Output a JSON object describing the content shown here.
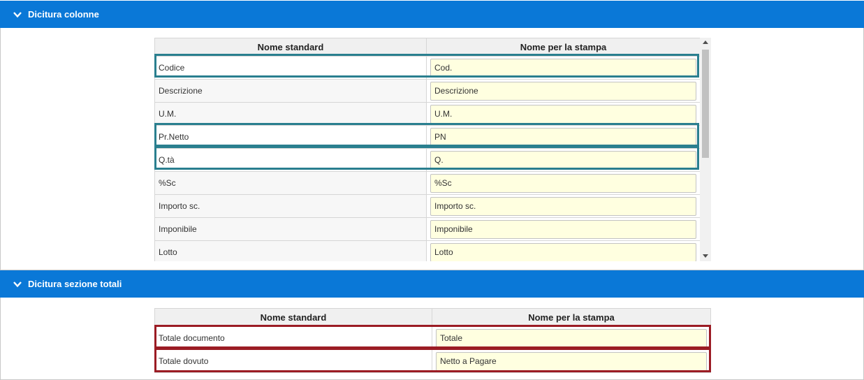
{
  "sections": {
    "columns": {
      "title": "Dicitura colonne",
      "header_std": "Nome standard",
      "header_print": "Nome per la stampa",
      "rows": [
        {
          "std": "Codice",
          "print": "Cod."
        },
        {
          "std": "Descrizione",
          "print": "Descrizione"
        },
        {
          "std": "U.M.",
          "print": "U.M."
        },
        {
          "std": "Pr.Netto",
          "print": "PN"
        },
        {
          "std": "Q.tà",
          "print": "Q."
        },
        {
          "std": "%Sc",
          "print": "%Sc"
        },
        {
          "std": "Importo sc.",
          "print": "Importo sc."
        },
        {
          "std": "Imponibile",
          "print": "Imponibile"
        },
        {
          "std": "Lotto",
          "print": "Lotto"
        }
      ]
    },
    "totals": {
      "title": "Dicitura sezione totali",
      "header_std": "Nome standard",
      "header_print": "Nome per la stampa",
      "rows": [
        {
          "std": "Totale documento",
          "print": "Totale"
        },
        {
          "std": "Totale dovuto",
          "print": "Netto a Pagare"
        }
      ]
    }
  },
  "colors": {
    "header_blue": "#0a78d7",
    "highlight_teal": "#2a7f8f",
    "highlight_red": "#9b1c24",
    "input_bg": "#ffffe0"
  }
}
